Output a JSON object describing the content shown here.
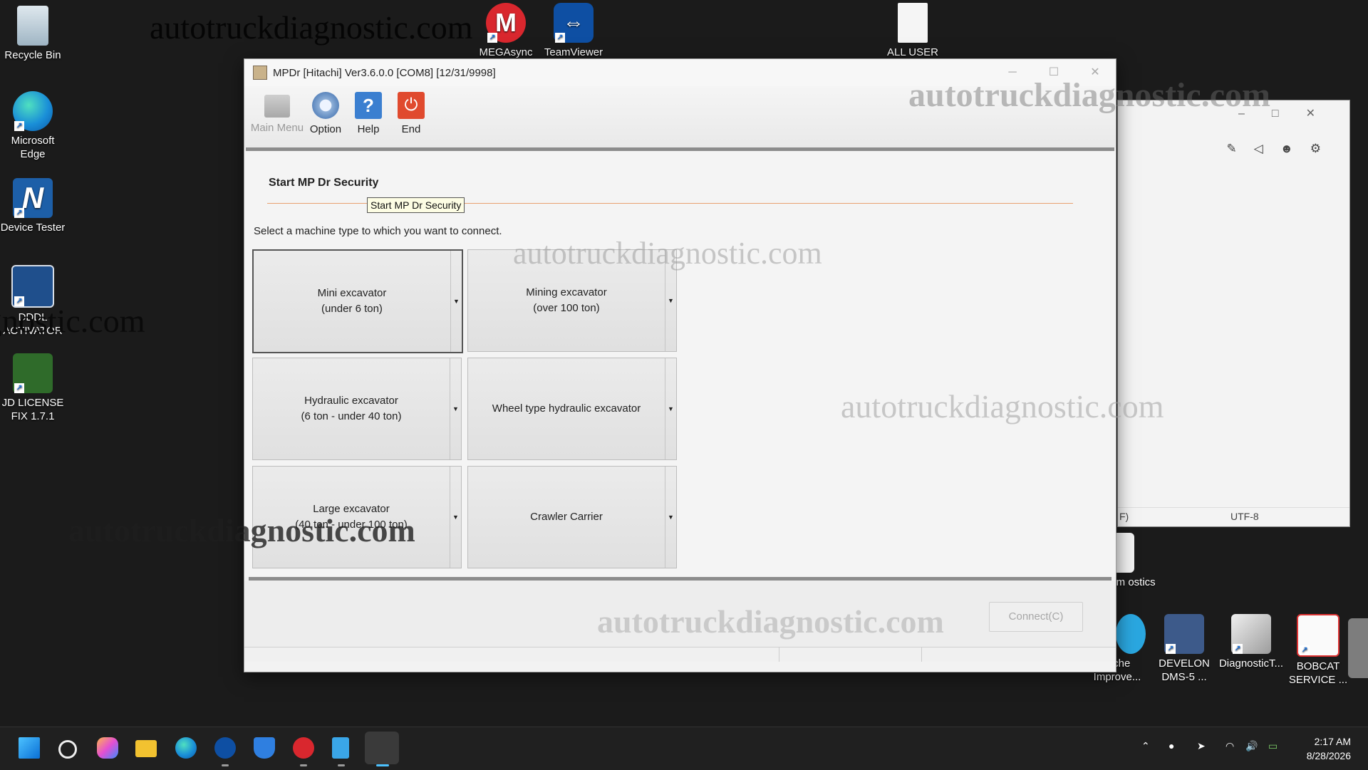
{
  "desktop": {
    "left_icons": [
      {
        "label": "Recycle Bin"
      },
      {
        "label": "Microsoft Edge"
      },
      {
        "label": "Device Tester"
      },
      {
        "label": "DDDL ACTIVATOR"
      },
      {
        "label": "JD LICENSE FIX 1.7.1"
      }
    ],
    "top_icons": [
      {
        "label": "MEGAsync"
      },
      {
        "label": "TeamViewer"
      },
      {
        "label": "ALL USER"
      }
    ],
    "right_icons": [
      {
        "label": "om ostics"
      },
      {
        "label": "tache Improve..."
      },
      {
        "label": "DEVELON DMS-5 ..."
      },
      {
        "label": "DiagnosticT..."
      },
      {
        "label": "BOBCAT SERVICE ..."
      }
    ]
  },
  "watermark": "autotruckdiagnostic.com",
  "background_window": {
    "status_left": "F)",
    "status_right": "UTF-8"
  },
  "window": {
    "title": "MPDr [Hitachi] Ver3.6.0.0 [COM8] [12/31/9998]",
    "toolbar": {
      "main_menu": "Main Menu",
      "option": "Option",
      "help": "Help",
      "end": "End"
    },
    "heading": "Start MP Dr Security",
    "tooltip": "Start MP Dr Security",
    "prompt": "Select a machine type to which you want to connect.",
    "machines": [
      {
        "line1": "Mini excavator",
        "line2": "(under 6 ton)"
      },
      {
        "line1": "Mining excavator",
        "line2": "(over 100 ton)"
      },
      {
        "line1": "Hydraulic excavator",
        "line2": "(6 ton - under 40 ton)"
      },
      {
        "line1": "Wheel type hydraulic excavator",
        "line2": ""
      },
      {
        "line1": "Large excavator",
        "line2": "(40 ton - under 100 ton)"
      },
      {
        "line1": "Crawler Carrier",
        "line2": ""
      }
    ],
    "connect": "Connect(C)"
  },
  "taskbar": {
    "time": "2:17 AM",
    "date": "8/28/2026"
  },
  "colors": {
    "desktop": "#1b1b1b",
    "accent_line": "#e9a070",
    "help_blue": "#3b7fd0",
    "end_red": "#e04a2e"
  }
}
